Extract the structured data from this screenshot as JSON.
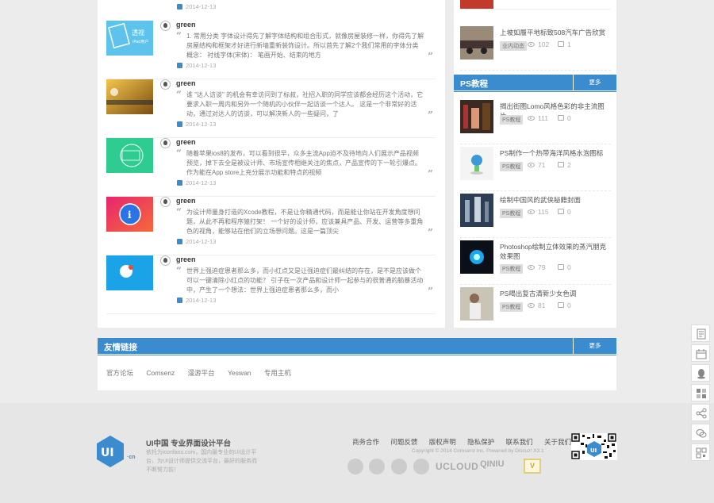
{
  "posts": [
    {
      "author": "green",
      "excerpt": "1. 常用分类 字体设计得先了解字体结构和组合形式，就像房屋装修一样，你得先了解房屋结构和框架才好进行新墙重新装饰设计。所以首先了解2个我们常用的字体分类概念： 衬线字体(宋体)： 笔画开始、结束的地方",
      "date": "2014-12-13"
    },
    {
      "author": "green",
      "excerpt": "谁 \"达人访谈\" 的机会有幸访问到了标叔，社招入职的同学应该都会经历这个活动，它要求入职一周内和另外一个随机的小伙伴一起访谈一个达人。 这是一个非常好的活动，通过对达人的访谈，可以解决新人的一些疑问，了",
      "date": "2014-12-13"
    },
    {
      "author": "green",
      "excerpt": "随着苹果ios8的发布，可以看到很早，众多主流App迫不及待地向人们展示产品视频预览，掉下去全是被设计师、市场宣传相继关注的焦点，产品宣传的下一轮引爆点。 作为能在App store上充分展示功能和特点的视频",
      "date": "2014-12-13"
    },
    {
      "author": "green",
      "excerpt": "为设计师量身打造的Xcode教程，不是让你精通代码，而是能让你站在开发角度想问题，从此不再和程序猿打架！ 一个好的设计师，应该兼具产品、开发、运营等多重角色的视角，能够站在他们的立场想问题。这是一篇顶尖",
      "date": "2014-12-13"
    },
    {
      "author": "green",
      "excerpt": "世界上强迫症患者那么多，而小红点又是让强迫症们最纠结的存在，是不是应该做个可以一键清除小红点的功能？ 引子在一次产品和设计师一起参与的很普通的脑暴活动中，产生了一个想法：世界上强迫症患者那么多，而小",
      "date": "2014-12-13"
    }
  ],
  "top_date": "2014-12-13",
  "side_top": {
    "title": "上坡如履平地标致508汽车广告欣赏",
    "tag": "业内动态",
    "views": "102",
    "comments": "1"
  },
  "ps_section": {
    "title": "PS教程",
    "more": "更多",
    "items": [
      {
        "title": "揭出街图Lomo风格色彩的非主流图片",
        "tag": "PS教程",
        "views": "111",
        "comments": "0"
      },
      {
        "title": "PS制作一个热带海洋风格水泡图标",
        "tag": "PS教程",
        "views": "71",
        "comments": "2"
      },
      {
        "title": "绘制中国风的武侠秘籍封面",
        "tag": "PS教程",
        "views": "115",
        "comments": "0"
      },
      {
        "title": "Photoshop绘制立体效果的蒸汽朋克效果图",
        "tag": "PS教程",
        "views": "79",
        "comments": "0"
      },
      {
        "title": "PS喝出复古清新少女色调",
        "tag": "PS教程",
        "views": "81",
        "comments": "0"
      }
    ]
  },
  "friends": {
    "title": "友情链接",
    "more": "更多",
    "links": [
      "官方论坛",
      "Comsenz",
      "漫游平台",
      "Yeswan",
      "专用主机"
    ]
  },
  "footer": {
    "logo_cn": "·cn",
    "brand_title": "UI中国 专业界面设计平台",
    "brand_desc": "依托为iconfans.com，国内最专业的UI设计平台，为UI设计师提供交流平台，最好的服务而不断努力前！",
    "links": [
      "商务合作",
      "问题反馈",
      "版权声明",
      "隐私保护",
      "联系我们",
      "关于我们"
    ],
    "copyright": "Copyright © 2014 Comsenz Inc. Powered by Discuz! X3.1",
    "ucloud": "UCLOUD",
    "qiniu": "QINIU",
    "vbadge": "V"
  },
  "colors": {
    "accent": "#3a8ccf"
  },
  "float_icons": [
    "note-icon",
    "calendar-icon",
    "qq-icon",
    "grid-icon",
    "share-icon",
    "wechat-icon",
    "qrcode-icon"
  ]
}
